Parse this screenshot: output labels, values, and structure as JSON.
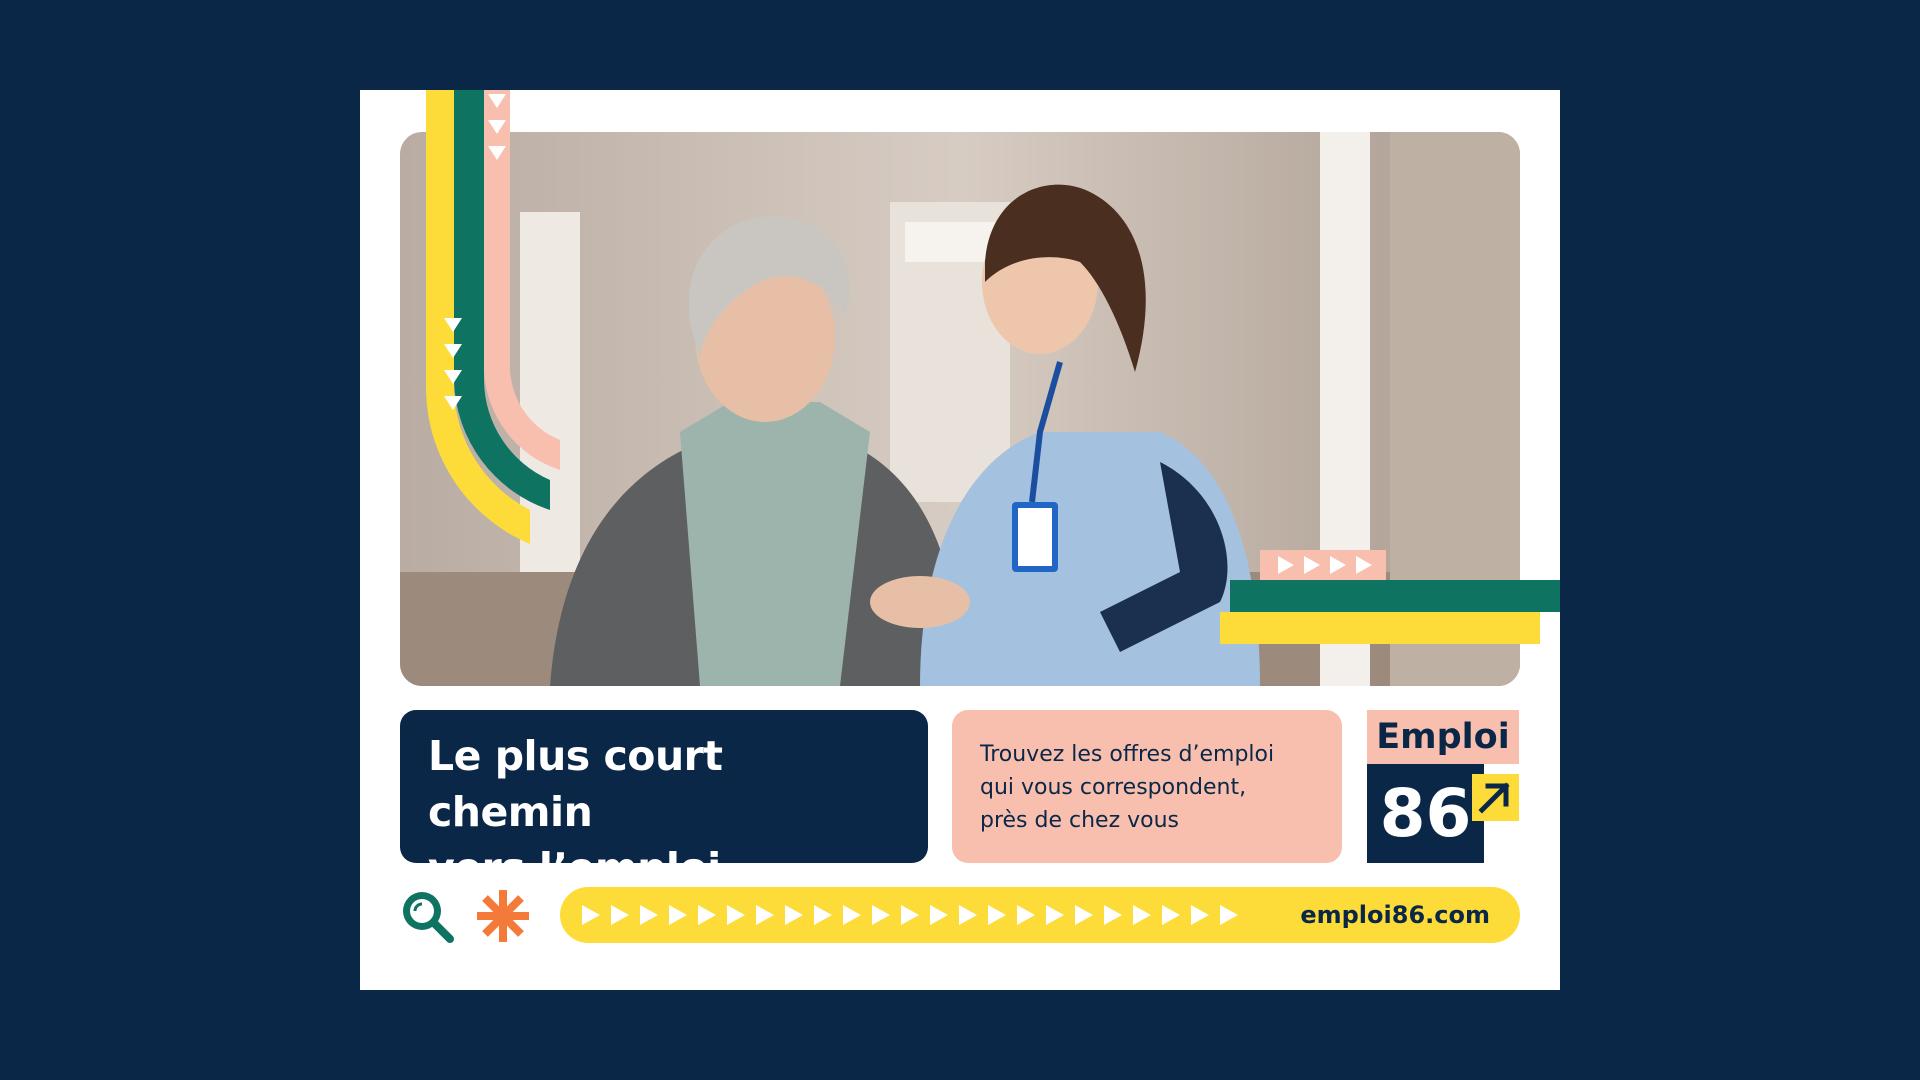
{
  "poster": {
    "headline_line1": "Le plus court chemin",
    "headline_line2": "vers l’emploi",
    "tagline_line1": "Trouvez les offres d’emploi",
    "tagline_line2": "qui vous correspondent,",
    "tagline_line3": "près de chez vous",
    "logo_word": "Emploi",
    "logo_number": "86",
    "website": "emploi86.com"
  },
  "colors": {
    "background": "#0b2748",
    "navy": "#0b2748",
    "yellow": "#fddc3a",
    "green": "#0f7362",
    "pink": "#f8bfae",
    "orange": "#f47a3a",
    "white": "#ffffff"
  },
  "icons": [
    "search-icon",
    "asterisk-icon",
    "arrow-up-right-icon",
    "triangle-arrow-icon"
  ]
}
